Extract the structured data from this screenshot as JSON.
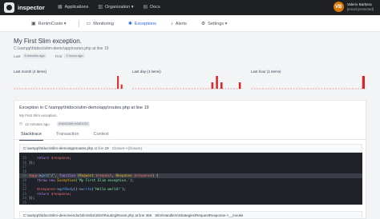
{
  "topbar": {
    "brand": "inspector",
    "nav": [
      {
        "icon": "grid-icon",
        "label": "Applications"
      },
      {
        "icon": "building-icon",
        "label": "Organization ▾"
      },
      {
        "icon": "book-icon",
        "label": "Docs"
      }
    ],
    "user": {
      "initials": "VB",
      "name": "Valerio Barbera",
      "email": "[email protected]"
    }
  },
  "subnav": {
    "items": [
      {
        "icon": "server-icon",
        "label": "RentmCosto ▾",
        "active": false
      },
      {
        "icon": "monitor-icon",
        "label": "Monitoring",
        "active": false
      },
      {
        "icon": "bug-icon",
        "label": "Exceptions",
        "active": true
      },
      {
        "icon": "bell-icon",
        "label": "Alerts",
        "active": false
      },
      {
        "icon": "gear-icon",
        "label": "Settings ▾",
        "active": false
      }
    ]
  },
  "exception": {
    "title": "My First Slim exception.",
    "path": "C:\\xampp\\htdocs\\slim-demo\\app\\routes.php at line 19",
    "last_label": "Last",
    "last_chip": "8 minutes ago",
    "first_label": "First",
    "first_chip": "3 hours ago"
  },
  "chart_data": [
    {
      "type": "bar",
      "title": "Last month (4 items)",
      "categories": [
        "d1",
        "d2",
        "d3",
        "d4",
        "d5",
        "d6",
        "d7",
        "d8",
        "d9",
        "d10",
        "d11",
        "d12",
        "d13",
        "d14",
        "d15",
        "d16",
        "d17",
        "d18",
        "d19",
        "d20",
        "d21",
        "d22",
        "d23",
        "d24",
        "d25",
        "d26",
        "d27",
        "d28",
        "d29",
        "d30"
      ],
      "values": [
        0,
        0,
        0,
        0,
        0,
        0,
        0,
        0,
        0,
        0,
        0,
        0,
        0,
        0,
        0,
        0,
        0,
        0,
        0,
        0,
        0,
        0,
        0,
        0,
        0,
        0,
        0,
        0,
        3,
        1
      ]
    },
    {
      "type": "bar",
      "title": "Last day (4 items)",
      "categories": [
        "h1",
        "h2",
        "h3",
        "h4",
        "h5",
        "h6",
        "h7",
        "h8",
        "h9",
        "h10",
        "h11",
        "h12",
        "h13",
        "h14",
        "h15",
        "h16",
        "h17",
        "h18",
        "h19",
        "h20",
        "h21",
        "h22",
        "h23",
        "h24"
      ],
      "values": [
        0,
        0,
        0,
        0,
        0,
        0,
        0,
        0,
        0,
        0,
        0,
        0,
        0,
        0,
        0,
        0,
        0,
        1,
        2,
        1,
        0,
        0,
        0,
        1
      ]
    },
    {
      "type": "bar",
      "title": "Last hour (1 items)",
      "categories": [
        "m1",
        "m2",
        "m3",
        "m4",
        "m5",
        "m6",
        "m7",
        "m8",
        "m9",
        "m10",
        "m11",
        "m12",
        "m13",
        "m14",
        "m15",
        "m16",
        "m17",
        "m18",
        "m19",
        "m20"
      ],
      "values": [
        0,
        0,
        0,
        0,
        0,
        0,
        0,
        0,
        0,
        0,
        0,
        0,
        0,
        0,
        0,
        0,
        0,
        0,
        0,
        1
      ]
    }
  ],
  "card": {
    "title_prefix": "Exception",
    "title_path": "in C:\\xampp\\htdocs\\slim-demo\\app\\routes.php at line 19",
    "message": "My First Slim exception.",
    "time": "12 minutes ago",
    "handled_chip": "UNKNOWN HANDLED",
    "tabs": [
      {
        "label": "Stacktrace",
        "active": true
      },
      {
        "label": "Transaction",
        "active": false
      },
      {
        "label": "Context",
        "active": false
      }
    ],
    "frame1": {
      "path": "C:\\xampp\\htdocs\\slim-demo\\app\\routes.php",
      "at": "at line",
      "line": "19",
      "closure": "Closure->{closure}"
    },
    "frame2": {
      "path": "C:\\xampp\\htdocs\\slim-demo\\vendor\\slim\\slim\\Slim\\Routing\\Route.php",
      "at": "at line",
      "line": "356",
      "closure": "Slim\\Handlers\\Strategies\\RequestResponse->__invoke"
    }
  },
  "code": {
    "lines": [
      {
        "n": "15",
        "hl": false,
        "parts": [
          [
            "    ",
            ""
          ],
          [
            "return",
            "kw"
          ],
          [
            " ",
            ""
          ],
          [
            "$response",
            "var"
          ],
          [
            ";",
            ""
          ]
        ]
      },
      {
        "n": "16",
        "hl": false,
        "parts": [
          [
            "});",
            ""
          ]
        ]
      },
      {
        "n": "17",
        "hl": false,
        "parts": [
          [
            "",
            ""
          ]
        ]
      },
      {
        "n": "18",
        "hl": false,
        "parts": [
          [
            "",
            ""
          ]
        ]
      },
      {
        "n": "19",
        "hl": true,
        "parts": [
          [
            "$app",
            "var"
          ],
          [
            "->",
            ""
          ],
          [
            "get",
            "fn"
          ],
          [
            "('/', ",
            ""
          ],
          [
            "function",
            "kw"
          ],
          [
            " (",
            ""
          ],
          [
            "Request",
            "cls"
          ],
          [
            " ",
            ""
          ],
          [
            "$request",
            "var"
          ],
          [
            ", ",
            ""
          ],
          [
            "Response",
            "cls"
          ],
          [
            " ",
            ""
          ],
          [
            "$response",
            "var"
          ],
          [
            ") {",
            ""
          ]
        ]
      },
      {
        "n": "20",
        "hl": false,
        "parts": [
          [
            "    ",
            ""
          ],
          [
            "throw",
            "kw"
          ],
          [
            " ",
            ""
          ],
          [
            "new",
            "kw"
          ],
          [
            " ",
            ""
          ],
          [
            "Exception",
            "cls"
          ],
          [
            "(",
            ""
          ],
          [
            "'My First Slim exception.'",
            "str"
          ],
          [
            ");",
            ""
          ]
        ]
      },
      {
        "n": "21",
        "hl": false,
        "parts": [
          [
            "",
            ""
          ]
        ]
      },
      {
        "n": "22",
        "hl": false,
        "parts": [
          [
            "    ",
            ""
          ],
          [
            "$response",
            "var"
          ],
          [
            "->",
            ""
          ],
          [
            "getBody",
            "fn"
          ],
          [
            "()->",
            ""
          ],
          [
            "write",
            "fn"
          ],
          [
            "(",
            ""
          ],
          [
            "'Hello world!'",
            "str"
          ],
          [
            ");",
            ""
          ]
        ]
      },
      {
        "n": "23",
        "hl": false,
        "parts": [
          [
            "    ",
            ""
          ],
          [
            "return",
            "kw"
          ],
          [
            " ",
            ""
          ],
          [
            "$response",
            "var"
          ],
          [
            ";",
            ""
          ]
        ]
      },
      {
        "n": "24",
        "hl": false,
        "parts": [
          [
            "});",
            ""
          ]
        ]
      },
      {
        "n": "25",
        "hl": false,
        "parts": [
          [
            "",
            ""
          ]
        ]
      }
    ]
  }
}
